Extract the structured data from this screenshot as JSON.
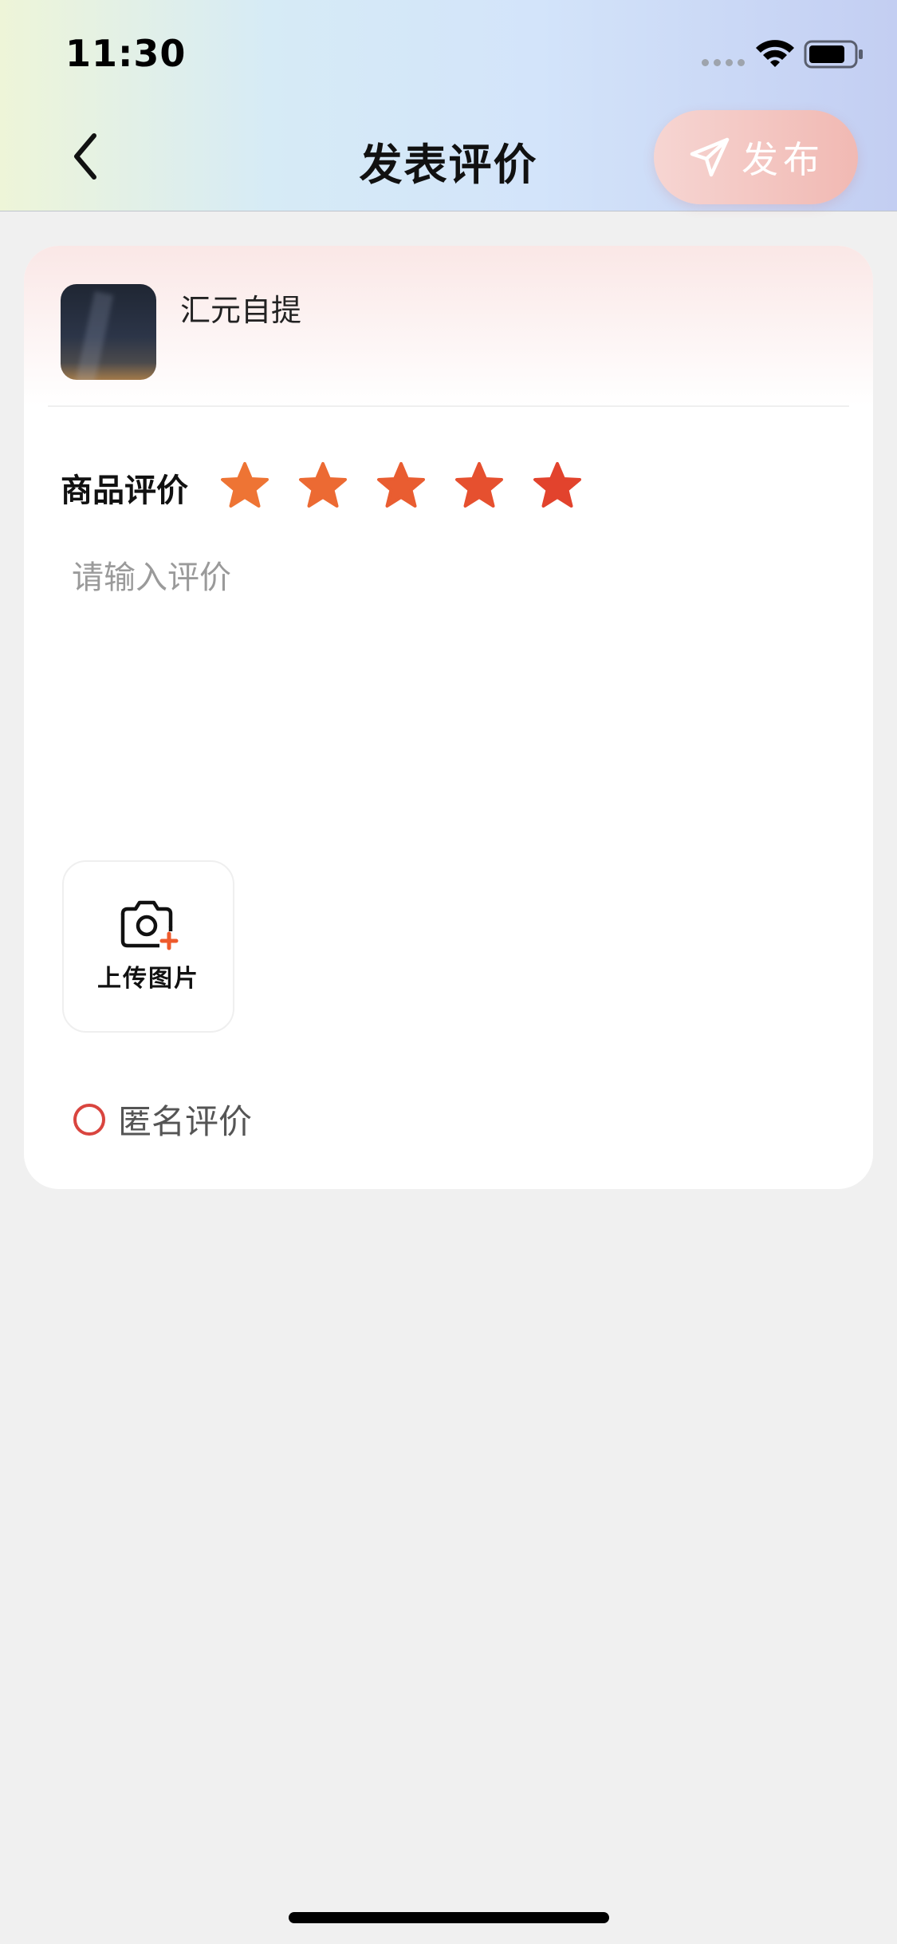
{
  "status_bar": {
    "time": "11:30"
  },
  "header": {
    "title": "发表评价",
    "publish_label": "发布"
  },
  "shop": {
    "name": "汇元自提"
  },
  "rating": {
    "label": "商品评价",
    "stars": 5,
    "max_stars": 5,
    "star_colors": [
      "#ee7434",
      "#ec6a33",
      "#e95d31",
      "#e6502f",
      "#e2432d"
    ]
  },
  "review": {
    "placeholder": "请输入评价",
    "value": ""
  },
  "upload": {
    "label": "上传图片"
  },
  "anonymous": {
    "label": "匿名评价",
    "checked": false
  },
  "colors": {
    "accent": "#e2432d",
    "radio_border": "#d9453f",
    "page_bg": "#f0f0f0"
  }
}
